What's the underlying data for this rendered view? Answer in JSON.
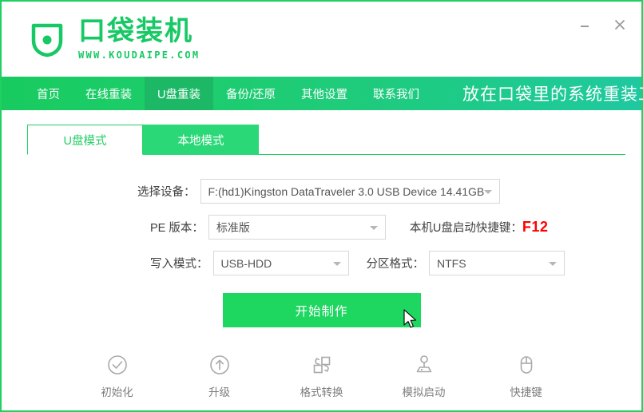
{
  "window": {
    "minimize_label": "—",
    "close_label": "✕"
  },
  "brand": {
    "logo_icon": "shield-dot-icon",
    "name": "口袋装机",
    "url": "WWW.KOUDAIPE.COM",
    "accent_color": "#17c964"
  },
  "nav": {
    "items": [
      {
        "label": "首页",
        "active": false
      },
      {
        "label": "在线重装",
        "active": false
      },
      {
        "label": "U盘重装",
        "active": true
      },
      {
        "label": "备份/还原",
        "active": false
      },
      {
        "label": "其他设置",
        "active": false
      },
      {
        "label": "联系我们",
        "active": false
      }
    ],
    "tagline": "放在口袋里的系统重装工具",
    "gradient_start": "#18cb5f",
    "gradient_end": "#1fc9a0",
    "active_bg": "#1cb866"
  },
  "tabs": [
    {
      "label": "U盘模式",
      "active": true
    },
    {
      "label": "本地模式",
      "active": false
    }
  ],
  "form": {
    "device": {
      "label": "选择设备：",
      "value": "F:(hd1)Kingston DataTraveler 3.0 USB Device 14.41GB",
      "caret_icon": "chevron-down-icon"
    },
    "pe_version": {
      "label": "PE 版本：",
      "value": "标准版",
      "caret_icon": "chevron-down-icon"
    },
    "hotkey": {
      "label": "本机U盘启动快捷键：",
      "value": "F12",
      "color": "#ff0000"
    },
    "write_mode": {
      "label": "写入模式：",
      "value": "USB-HDD",
      "caret_icon": "chevron-down-icon"
    },
    "partition_format": {
      "label": "分区格式：",
      "value": "NTFS",
      "caret_icon": "chevron-down-icon"
    }
  },
  "cta": {
    "label": "开始制作",
    "color": "#1ed761"
  },
  "tools": [
    {
      "label": "初始化",
      "icon": "check-circle-icon"
    },
    {
      "label": "升级",
      "icon": "arrow-up-circle-icon"
    },
    {
      "label": "格式转换",
      "icon": "format-convert-icon"
    },
    {
      "label": "模拟启动",
      "icon": "joystick-icon"
    },
    {
      "label": "快捷键",
      "icon": "mouse-icon"
    }
  ]
}
